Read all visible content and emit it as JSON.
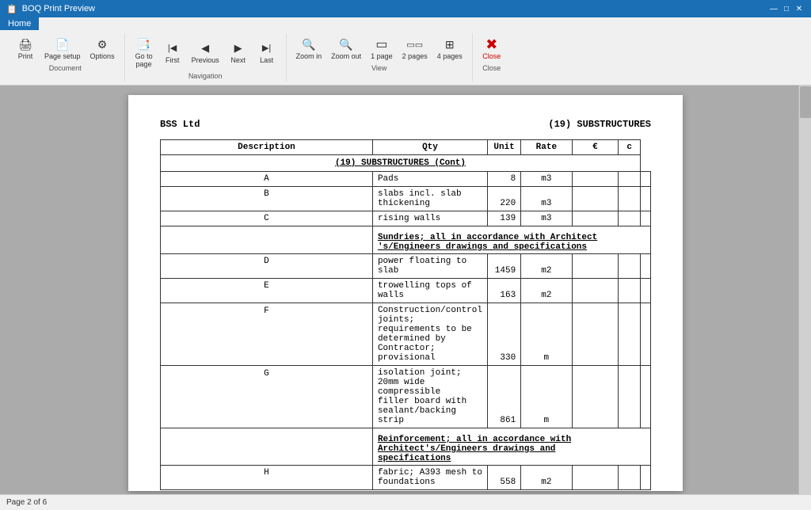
{
  "titleBar": {
    "title": "BOQ Print Preview",
    "controls": [
      "—",
      "□",
      "✕"
    ]
  },
  "ribbon": {
    "tab": "Home",
    "groups": [
      {
        "name": "Document",
        "label": "Document",
        "buttons": [
          {
            "label": "Print",
            "icon": "🖨"
          },
          {
            "label": "Page setup",
            "icon": "📄"
          },
          {
            "label": "Options",
            "icon": "⚙"
          }
        ]
      },
      {
        "name": "Navigation",
        "label": "Navigation",
        "buttons": [
          {
            "label": "Go to page",
            "icon": "📑"
          },
          {
            "label": "First",
            "icon": "|◀"
          },
          {
            "label": "Previous",
            "icon": "◀"
          },
          {
            "label": "Next",
            "icon": "▶"
          },
          {
            "label": "Last",
            "icon": "▶|"
          }
        ]
      },
      {
        "name": "View",
        "label": "View",
        "buttons": [
          {
            "label": "Zoom in",
            "icon": "🔍+"
          },
          {
            "label": "Zoom out",
            "icon": "🔍-"
          },
          {
            "label": "1 page",
            "icon": "▭"
          },
          {
            "label": "2 pages",
            "icon": "▭▭"
          },
          {
            "label": "4 pages",
            "icon": "⊞"
          }
        ]
      },
      {
        "name": "Close",
        "label": "Close",
        "buttons": [
          {
            "label": "Close",
            "icon": "✕"
          }
        ]
      }
    ]
  },
  "document": {
    "company": "BSS Ltd",
    "section": "(19)  SUBSTRUCTURES",
    "tableHeaders": [
      "Description",
      "Qty",
      "Unit",
      "Rate",
      "€",
      "c"
    ],
    "sectionTitle": "(19)  SUBSTRUCTURES (Cont)",
    "rows": [
      {
        "letter": "A",
        "desc": "Pads",
        "qty": "8",
        "unit": "m3"
      },
      {
        "letter": "B",
        "desc": "slabs incl. slab thickening",
        "qty": "220",
        "unit": "m3"
      },
      {
        "letter": "C",
        "desc": "rising walls",
        "qty": "139",
        "unit": "m3"
      }
    ],
    "sundriesHeader": "Sundries; all in accordance with Architect\n's/Engineers drawings and specifications",
    "sundriesRows": [
      {
        "letter": "D",
        "desc": "power floating to slab",
        "qty": "1459",
        "unit": "m2"
      },
      {
        "letter": "E",
        "desc": "trowelling tops of walls",
        "qty": "163",
        "unit": "m2"
      },
      {
        "letter": "F",
        "desc": "Construction/control joints;\nrequirements to be determined by\nContractor; provisional",
        "qty": "330",
        "unit": "m"
      },
      {
        "letter": "G",
        "desc": "isolation joint; 20mm wide compressible\nfiller board with sealant/backing strip",
        "qty": "861",
        "unit": "m"
      }
    ],
    "reinforcementHeader": "Reinforcement; all in accordance with\nArchitect's/Engineers drawings and\nspecifications",
    "reinforcementRows": [
      {
        "letter": "H",
        "desc": "fabric; A393 mesh to foundations",
        "qty": "558",
        "unit": "m2"
      }
    ]
  },
  "statusBar": {
    "text": "Page 2 of 6"
  }
}
